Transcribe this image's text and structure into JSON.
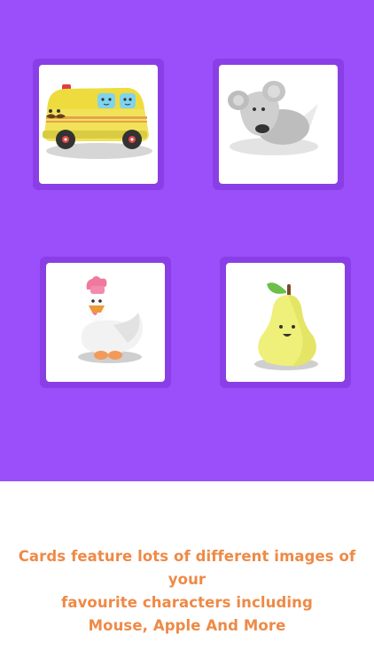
{
  "colors": {
    "background_accent": "#9b4ffb",
    "card_border": "#8a3fe6",
    "caption_text": "#ee8a47"
  },
  "cards": [
    {
      "name": "bus",
      "icon": "bus-character-icon"
    },
    {
      "name": "mouse",
      "icon": "mouse-character-icon"
    },
    {
      "name": "duck",
      "icon": "duck-character-icon"
    },
    {
      "name": "pear",
      "icon": "pear-character-icon"
    }
  ],
  "caption": {
    "line1": "Cards feature lots of different images of your",
    "line2": "favourite characters including",
    "line3": "Mouse, Apple And More"
  }
}
